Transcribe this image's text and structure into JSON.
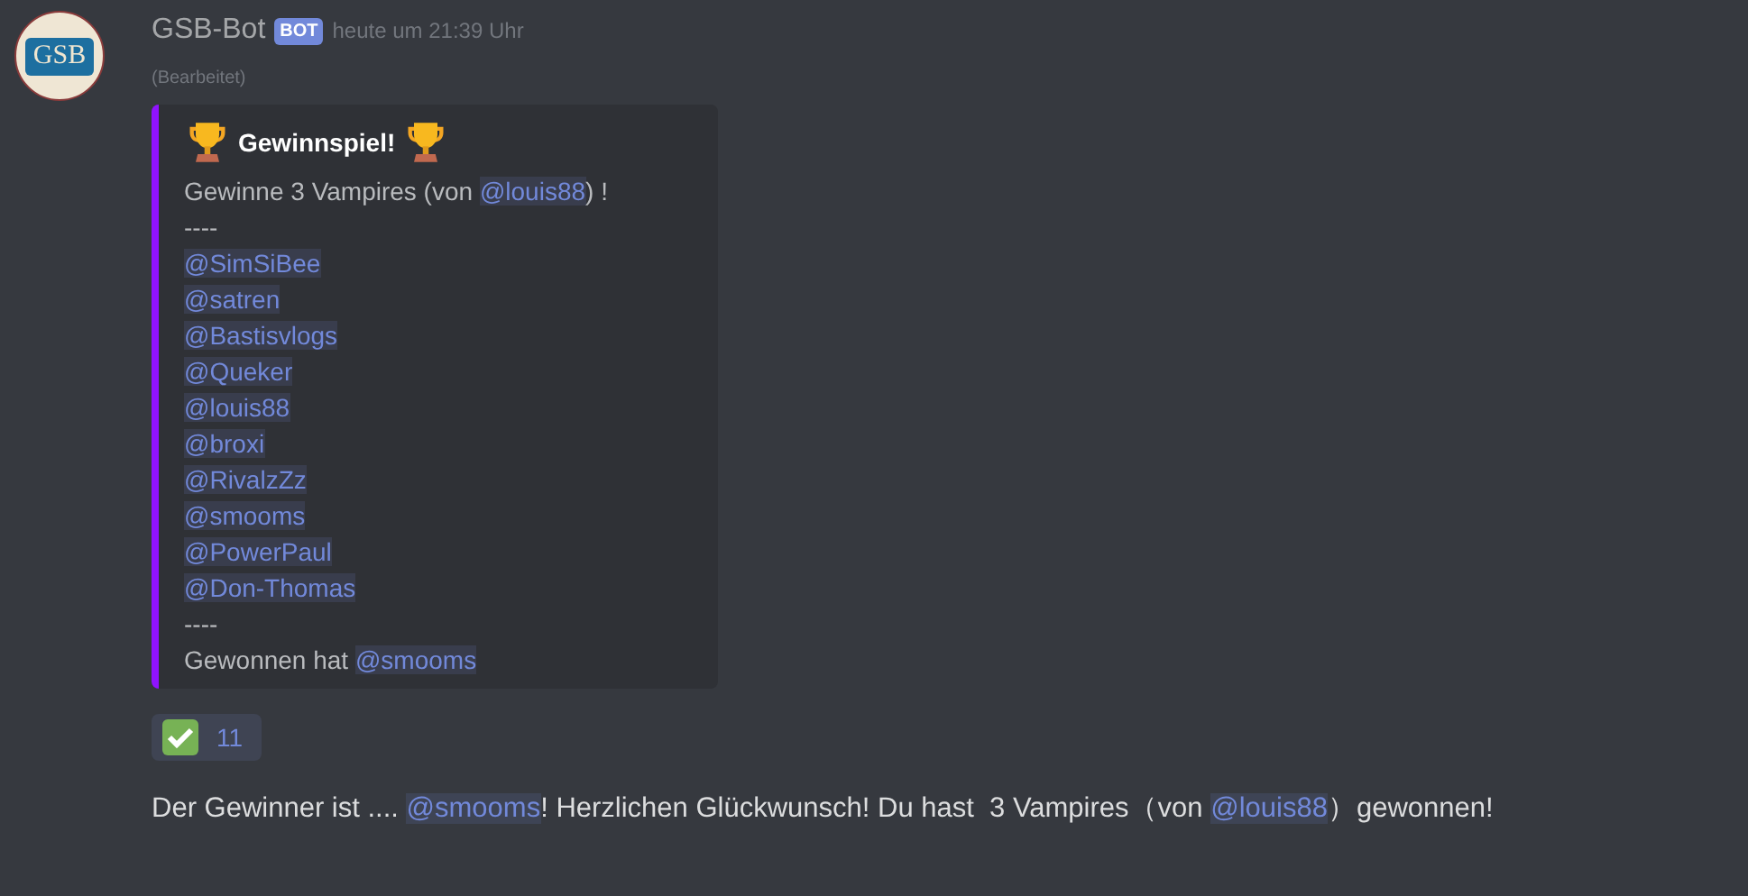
{
  "message": {
    "avatar_text": "GSB",
    "author": "GSB-Bot",
    "badge": "BOT",
    "timestamp": "heute um 21:39 Uhr",
    "edited": "(Bearbeitet)"
  },
  "embed": {
    "title": "Gewinnspiel!",
    "lines": [
      {
        "parts": [
          {
            "kind": "text",
            "text": "Gewinne 3 Vampires (von "
          },
          {
            "kind": "mention",
            "text": "@louis88"
          },
          {
            "kind": "text",
            "text": ") !"
          }
        ]
      },
      {
        "parts": [
          {
            "kind": "text",
            "text": "----"
          }
        ]
      },
      {
        "parts": [
          {
            "kind": "mention",
            "text": "@SimSiBee"
          }
        ]
      },
      {
        "parts": [
          {
            "kind": "mention",
            "text": "@satren"
          }
        ]
      },
      {
        "parts": [
          {
            "kind": "mention",
            "text": "@Bastisvlogs"
          }
        ]
      },
      {
        "parts": [
          {
            "kind": "mention",
            "text": "@Queker"
          }
        ]
      },
      {
        "parts": [
          {
            "kind": "mention",
            "text": "@louis88"
          }
        ]
      },
      {
        "parts": [
          {
            "kind": "mention",
            "text": "@broxi"
          }
        ]
      },
      {
        "parts": [
          {
            "kind": "mention",
            "text": "@RivalzZz"
          }
        ]
      },
      {
        "parts": [
          {
            "kind": "mention",
            "text": "@smooms"
          }
        ]
      },
      {
        "parts": [
          {
            "kind": "mention",
            "text": "@PowerPaul"
          }
        ]
      },
      {
        "parts": [
          {
            "kind": "mention",
            "text": "@Don-Thomas"
          }
        ]
      },
      {
        "parts": [
          {
            "kind": "text",
            "text": "----"
          }
        ]
      },
      {
        "parts": [
          {
            "kind": "text",
            "text": "Gewonnen hat "
          },
          {
            "kind": "mention",
            "text": "@smooms"
          }
        ]
      }
    ]
  },
  "reaction": {
    "count": "11"
  },
  "followup": {
    "parts": [
      {
        "kind": "text",
        "text": "Der Gewinner ist .... "
      },
      {
        "kind": "mention",
        "text": "@smooms"
      },
      {
        "kind": "text",
        "text": "! Herzlichen Glückwunsch! Du hast  3 Vampires（von "
      },
      {
        "kind": "mention",
        "text": "@louis88"
      },
      {
        "kind": "text",
        "text": "）gewonnen!"
      }
    ]
  }
}
